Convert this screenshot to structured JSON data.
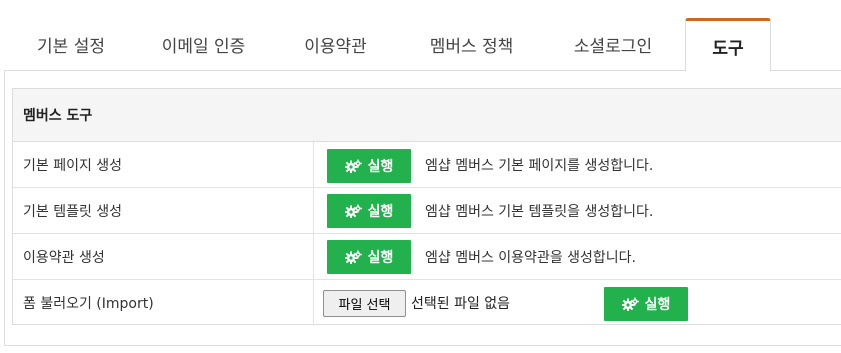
{
  "tabs": [
    {
      "label": "기본 설정",
      "active": false
    },
    {
      "label": "이메일 인증",
      "active": false
    },
    {
      "label": "이용약관",
      "active": false
    },
    {
      "label": "멤버스 정책",
      "active": false
    },
    {
      "label": "소셜로그인",
      "active": false
    },
    {
      "label": "도구",
      "active": true
    }
  ],
  "section_title": "멤버스 도구",
  "rows": [
    {
      "label": "기본 페이지 생성",
      "button": "실행",
      "description": "엠샵 멤버스 기본 페이지를 생성합니다."
    },
    {
      "label": "기본 템플릿 생성",
      "button": "실행",
      "description": "엠샵 멤버스 기본 템플릿을 생성합니다."
    },
    {
      "label": "이용약관 생성",
      "button": "실행",
      "description": "엠샵 멤버스 이용약관을 생성합니다."
    }
  ],
  "import_row": {
    "label": "폼 불러오기 (Import)",
    "file_button": "파일 선택",
    "file_status": "선택된 파일 없음",
    "button": "실행"
  },
  "colors": {
    "accent_tab": "#c46b1e",
    "run_button": "#22b14c"
  },
  "icons": {
    "run_button": "gears-icon"
  }
}
